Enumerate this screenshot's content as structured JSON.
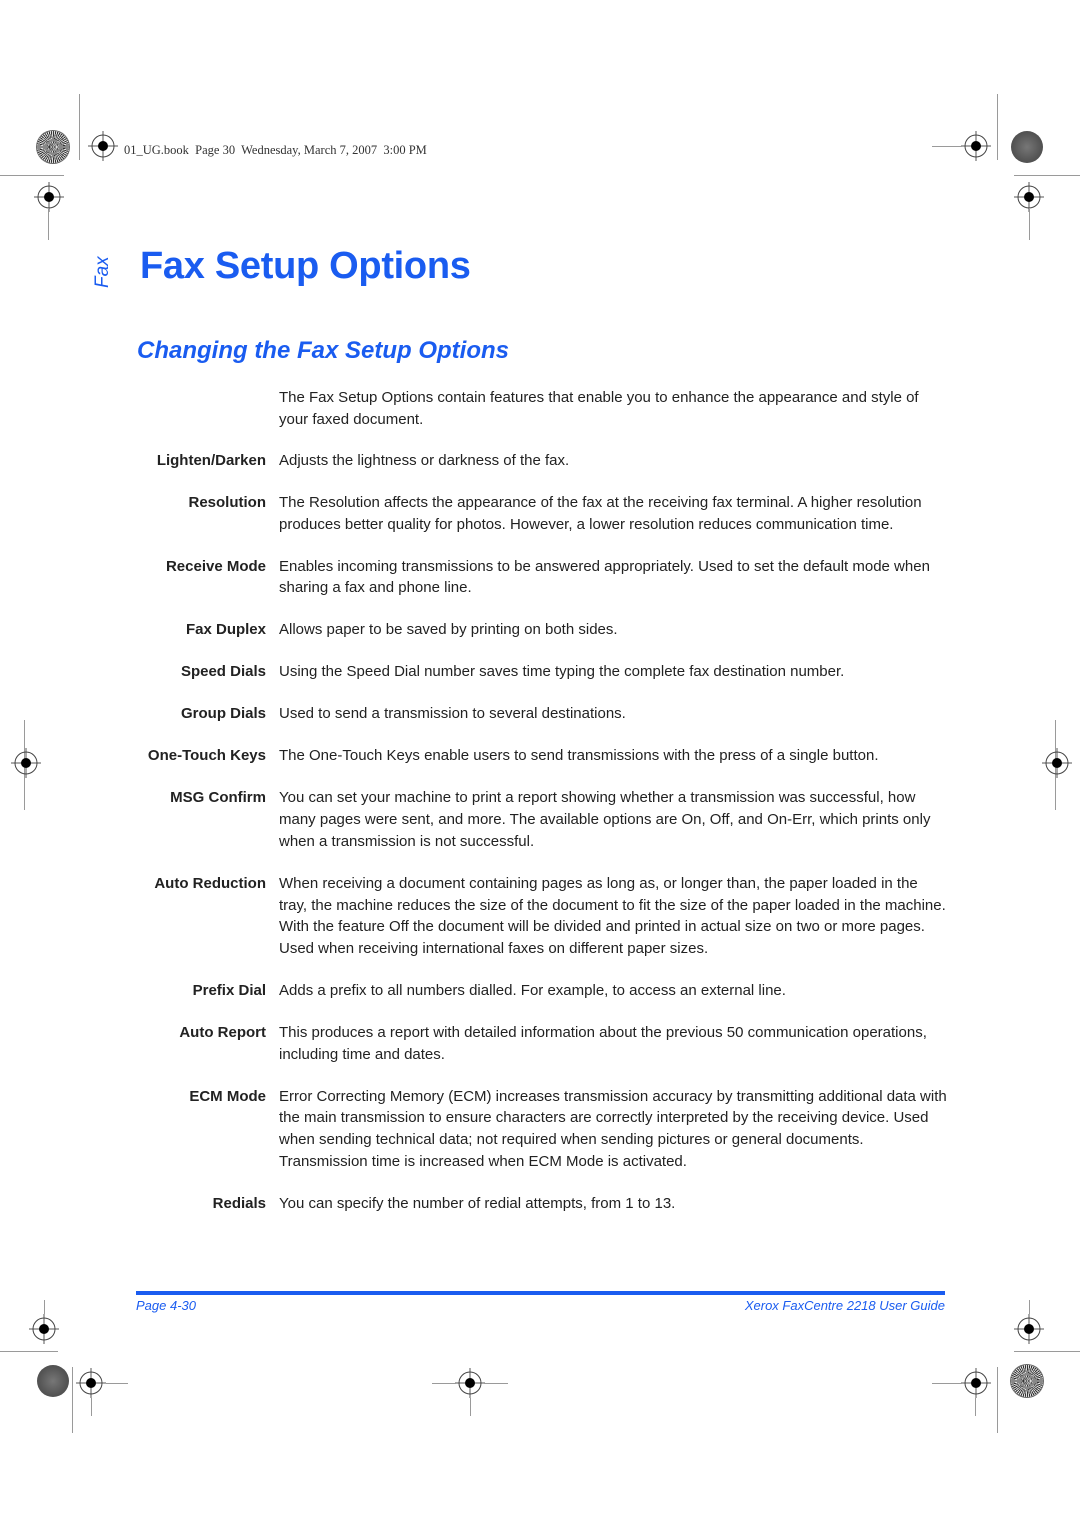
{
  "header": {
    "stamp": "01_UG.book  Page 30  Wednesday, March 7, 2007  3:00 PM"
  },
  "side_tab": "Fax",
  "title": "Fax Setup Options",
  "subtitle": "Changing the Fax Setup Options",
  "intro": "The Fax Setup Options contain features that enable you to enhance the appearance and style of your faxed document.",
  "definitions": [
    {
      "term": "Lighten/Darken",
      "desc": "Adjusts the lightness or darkness of the fax."
    },
    {
      "term": "Resolution",
      "desc": "The Resolution affects the appearance of the fax at the receiving fax terminal. A higher resolution produces better quality for photos. However, a lower resolution reduces communication time."
    },
    {
      "term": "Receive Mode",
      "desc": "Enables incoming transmissions to be answered appropriately. Used to set the default mode when sharing a fax and phone line."
    },
    {
      "term": "Fax Duplex",
      "desc": "Allows paper to be saved by printing on both sides."
    },
    {
      "term": "Speed Dials",
      "desc": "Using the Speed Dial number saves time typing the complete fax destination number."
    },
    {
      "term": "Group Dials",
      "desc": "Used to send a transmission to several destinations."
    },
    {
      "term": "One-Touch Keys",
      "desc": "The One-Touch Keys enable users to send transmissions with the press of a single button."
    },
    {
      "term": "MSG Confirm",
      "desc": "You can set your machine to print a report showing whether a transmission was successful, how many pages were sent, and more. The available options are On, Off, and On-Err, which prints only when a transmission is not successful."
    },
    {
      "term": "Auto Reduction",
      "desc": "When receiving a document containing pages as long as, or longer than, the paper loaded in the tray, the machine reduces the size of the document to fit the size of the paper loaded in the machine. With the feature Off the document will be divided and printed in actual size on two or more pages. Used when receiving international faxes on different paper sizes."
    },
    {
      "term": "Prefix Dial",
      "desc": "Adds a prefix to all numbers dialled. For example, to access an external line."
    },
    {
      "term": "Auto Report",
      "desc": "This produces a report with detailed information about the previous 50 communication operations, including time and dates."
    },
    {
      "term": "ECM Mode",
      "desc": "Error Correcting Memory (ECM) increases transmission accuracy by transmitting additional data with the main transmission to ensure characters are correctly interpreted by the receiving device. Used when sending technical data; not required when sending pictures or general documents. Transmission time is increased when ECM Mode is activated."
    },
    {
      "term": "Redials",
      "desc": "You can specify the number of redial attempts, from 1 to 13."
    }
  ],
  "footer": {
    "page_label": "Page 4-30",
    "guide_title": "Xerox FaxCentre 2218 User Guide"
  },
  "colors": {
    "accent": "#1a5cf0",
    "body_text": "#222222"
  }
}
